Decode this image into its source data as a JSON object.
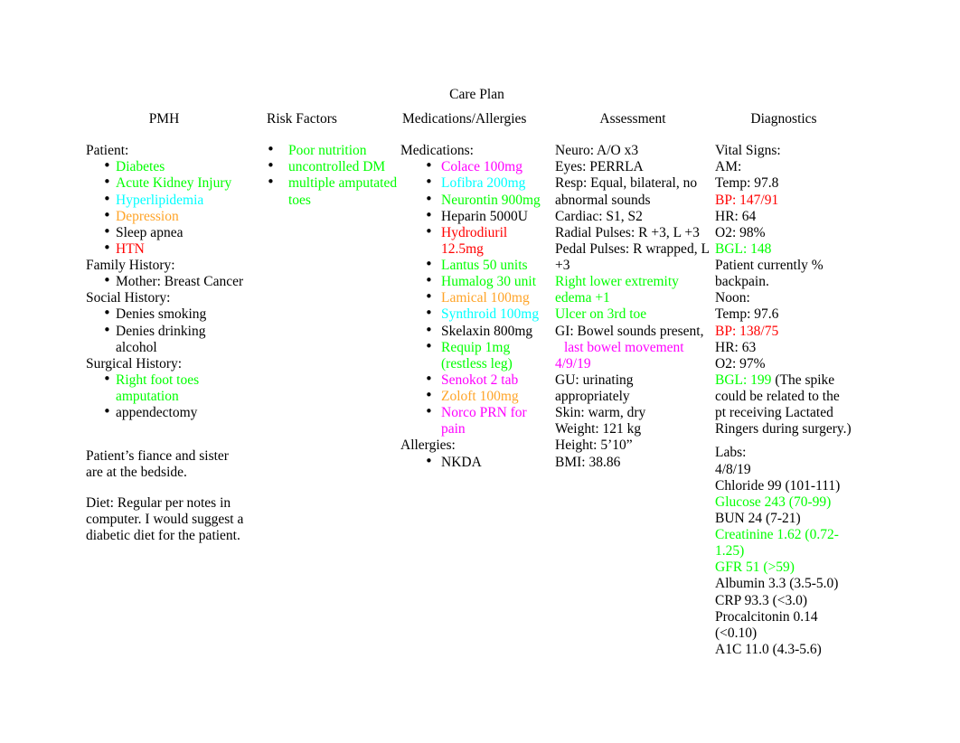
{
  "document": {
    "title": "Care Plan"
  },
  "columns": {
    "pmh": {
      "heading": "PMH",
      "patient_label": "Patient:",
      "patient_items": [
        {
          "text": "Diabetes",
          "color": "green"
        },
        {
          "text": "Acute Kidney Injury",
          "color": "green"
        },
        {
          "text": "Hyperlipidemia",
          "color": "cyan"
        },
        {
          "text": "Depression",
          "color": "orange"
        },
        {
          "text": "Sleep apnea",
          "color": "black"
        },
        {
          "text": "HTN",
          "color": "red"
        }
      ],
      "family_history_label": "Family History:",
      "family_history_items": [
        {
          "text": "Mother: Breast Cancer",
          "color": "black"
        }
      ],
      "social_history_label": "Social History:",
      "social_history_items": [
        {
          "text": "Denies smoking",
          "color": "black"
        },
        {
          "text": "Denies drinking alcohol",
          "color": "black"
        }
      ],
      "surgical_history_label": "Surgical History:",
      "surgical_history_items": [
        {
          "text": "Right foot toes amputation",
          "color": "green"
        },
        {
          "text": "appendectomy",
          "color": "black"
        }
      ],
      "note_family": "Patient’s fiance and sister are at the bedside.",
      "note_diet": "Diet: Regular per notes in computer. I would suggest a diabetic diet for the patient."
    },
    "risk_factors": {
      "heading": "Risk Factors",
      "items": [
        {
          "text": "Poor nutrition",
          "color": "green"
        },
        {
          "text": "uncontrolled DM",
          "color": "green"
        },
        {
          "text": "multiple amputated toes",
          "color": "green"
        }
      ]
    },
    "medications": {
      "heading": "Medications/Allergies",
      "medications_label": "Medications:",
      "items": [
        {
          "text": "Colace 100mg",
          "color": "magenta"
        },
        {
          "text": "Lofibra 200mg",
          "color": "cyan"
        },
        {
          "text": "Neurontin 900mg",
          "color": "green"
        },
        {
          "text": "Heparin 5000U",
          "color": "black"
        },
        {
          "text": "Hydrodiuril 12.5mg",
          "color": "red"
        },
        {
          "text": "Lantus 50 units",
          "color": "green"
        },
        {
          "text": "Humalog 30 unit",
          "color": "green"
        },
        {
          "text": "Lamical 100mg",
          "color": "orange"
        },
        {
          "text": "Synthroid 100mg",
          "color": "cyan"
        },
        {
          "text": "Skelaxin 800mg",
          "color": "black"
        },
        {
          "text": "Requip 1mg (restless leg)",
          "color": "green"
        },
        {
          "text": "Senokot 2 tab",
          "color": "magenta"
        },
        {
          "text": "Zoloft 100mg",
          "color": "orange"
        },
        {
          "text": "Norco PRN for pain",
          "color": "magenta"
        }
      ],
      "allergies_label": "Allergies:",
      "allergies_items": [
        {
          "text": "NKDA",
          "color": "black"
        }
      ]
    },
    "assessment": {
      "heading": "Assessment",
      "lines": [
        {
          "text": "Neuro:   A/O x3",
          "color": "black"
        },
        {
          "text": "Eyes:   PERRLA",
          "color": "black"
        },
        {
          "text": "Resp:   Equal, bilateral, no abnormal sounds",
          "color": "black"
        },
        {
          "text": "Cardiac:   S1, S2",
          "color": "black"
        },
        {
          "text": "Radial Pulses:      R +3, L +3",
          "color": "black"
        },
        {
          "text": "Pedal Pulses:       R wrapped, L +3",
          "color": "black"
        },
        {
          "text": "Right lower extremity edema +1",
          "color": "green"
        },
        {
          "text": "Ulcer on 3rd toe",
          "color": "green"
        }
      ],
      "gi_prefix": "GI:  Bowel sounds present,",
      "gi_highlight": "last bowel movement 4/9/19",
      "lines_after": [
        {
          "text": "GU:  urinating appropriately",
          "color": "black"
        },
        {
          "text": "Skin:   warm, dry",
          "color": "black"
        },
        {
          "text": "Weight:    121 kg",
          "color": "black"
        },
        {
          "text": "Height:   5’10”",
          "color": "black"
        },
        {
          "text": "BMI: 38.86",
          "color": "black"
        }
      ]
    },
    "diagnostics": {
      "heading": "Diagnostics",
      "vitals_label": "Vital Signs:",
      "am_label": "AM:",
      "am_lines": [
        {
          "text": "Temp: 97.8",
          "color": "black"
        },
        {
          "text": "BP: 147/91",
          "color": "red"
        },
        {
          "text": "HR: 64",
          "color": "black"
        },
        {
          "text": "O2: 98%",
          "color": "black"
        },
        {
          "text": "BGL: 148",
          "color": "green"
        },
        {
          "text": "Patient currently % backpain.",
          "color": "black"
        }
      ],
      "noon_label": "Noon:",
      "noon_lines": [
        {
          "text": "Temp: 97.6",
          "color": "black"
        },
        {
          "text": "BP: 138/75",
          "color": "red"
        },
        {
          "text": "HR: 63",
          "color": "black"
        },
        {
          "text": "O2: 97%",
          "color": "black"
        }
      ],
      "bgl_noon": "BGL: 199",
      "bgl_noon_note": "(The spike could be related to the pt receiving Lactated Ringers during surgery.)",
      "labs_label": "Labs:",
      "labs_date": "4/8/19",
      "labs": [
        {
          "text": "Chloride 99 (101-111)",
          "color": "black"
        },
        {
          "text": "Glucose 243 (70-99)",
          "color": "green"
        },
        {
          "text": "BUN 24 (7-21)",
          "color": "black"
        },
        {
          "text": "Creatinine 1.62 (0.72-1.25)",
          "color": "green"
        },
        {
          "text": "GFR 51 (>59)",
          "color": "green"
        },
        {
          "text": "Albumin 3.3 (3.5-5.0)",
          "color": "black"
        },
        {
          "text": "CRP 93.3 (<3.0)",
          "color": "black"
        },
        {
          "text": "Procalcitonin 0.14 (<0.10)",
          "color": "black"
        },
        {
          "text": "A1C 11.0 (4.3-5.6)",
          "color": "black"
        }
      ]
    }
  }
}
